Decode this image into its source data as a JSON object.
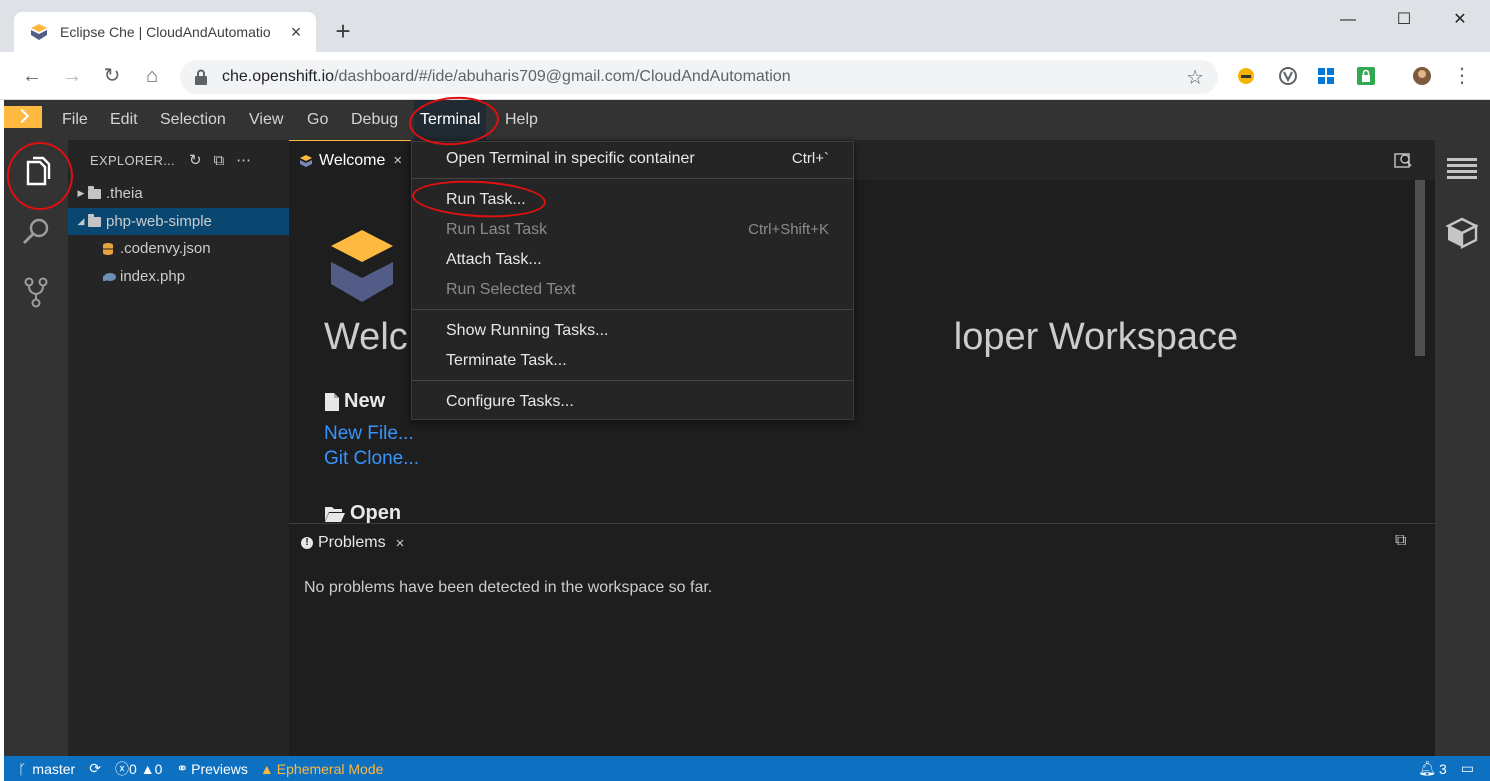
{
  "browser": {
    "tab_title": "Eclipse Che | CloudAndAutomatio",
    "tab_close": "×",
    "new_tab": "+",
    "window_controls": {
      "minimize": "—",
      "maximize": "☐",
      "close": "✕"
    },
    "url_host": "che.openshift.io",
    "url_path": "/dashboard/#/ide/abuharis709@gmail.com/CloudAndAutomation",
    "nav": {
      "back": "←",
      "forward": "→",
      "reload": "↻",
      "home": "⌂"
    },
    "star": "☆",
    "extensions": [
      "key-icon",
      "vivaldi-icon",
      "windows-icon",
      "lock-icon",
      "avatar-icon"
    ],
    "menu_dots": "⋮"
  },
  "ide": {
    "menu": [
      "File",
      "Edit",
      "Selection",
      "View",
      "Go",
      "Debug",
      "Terminal",
      "Help"
    ],
    "active_menu": "Terminal",
    "explorer": {
      "title": "EXPLORER...",
      "tree": [
        {
          "label": ".theia",
          "type": "folder",
          "expanded": false,
          "level": 0
        },
        {
          "label": "php-web-simple",
          "type": "folder",
          "expanded": true,
          "level": 0,
          "selected": true
        },
        {
          "label": ".codenvy.json",
          "type": "file",
          "icon": "json-db-icon",
          "level": 1
        },
        {
          "label": "index.php",
          "type": "file",
          "icon": "php-elephant-icon",
          "level": 1
        }
      ]
    },
    "editor_tab": {
      "label": "Welcome",
      "close": "×"
    },
    "welcome": {
      "title_left": "Welc",
      "title_right": "loper Workspace",
      "new_heading": "New",
      "links": [
        "New File...",
        "Git Clone..."
      ],
      "open_heading": "Open"
    },
    "panel": {
      "tab_label": "Problems",
      "tab_close": "×",
      "message": "No problems have been detected in the workspace so far."
    },
    "terminal_menu": [
      {
        "label": "Open Terminal in specific container",
        "shortcut": "Ctrl+`",
        "disabled": false
      },
      {
        "label": "Run Task...",
        "shortcut": "",
        "disabled": false
      },
      {
        "label": "Run Last Task",
        "shortcut": "Ctrl+Shift+K",
        "disabled": true
      },
      {
        "label": "Attach Task...",
        "shortcut": "",
        "disabled": false
      },
      {
        "label": "Run Selected Text",
        "shortcut": "",
        "disabled": true
      },
      {
        "label": "Show Running Tasks...",
        "shortcut": "",
        "disabled": false
      },
      {
        "label": "Terminate Task...",
        "shortcut": "",
        "disabled": false
      },
      {
        "label": "Configure Tasks...",
        "shortcut": "",
        "disabled": false
      }
    ],
    "statusbar": {
      "branch": "master",
      "errors": "0",
      "warnings": "0",
      "previews": "Previews",
      "mode": "Ephemeral Mode",
      "notifications": "3"
    }
  },
  "colors": {
    "accent": "#fdb940",
    "statusbar": "#0e70c0",
    "link": "#3794ff",
    "annotation": "#e01010"
  }
}
